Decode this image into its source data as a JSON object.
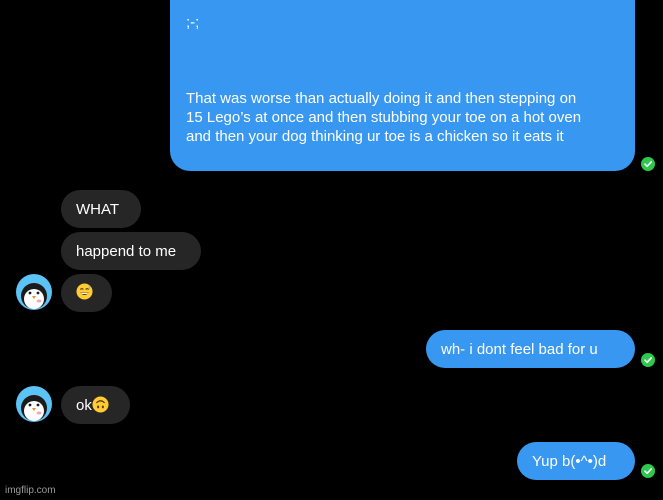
{
  "colors": {
    "background": "#000000",
    "outgoing_bubble": "#3897f0",
    "incoming_bubble": "#262626",
    "read_check": "#2dc84d"
  },
  "messages": [
    {
      "direction": "outgoing",
      "lines": [
        ";-;",
        "",
        "",
        "",
        "That was worse than actually doing it and then stepping on",
        "15 Lego’s at once and then stubbing your toe on a hot oven",
        "and then your dog thinking ur toe is a chicken so it eats it"
      ],
      "status_icon": "check-circle-icon"
    },
    {
      "direction": "incoming",
      "text": "WHAT"
    },
    {
      "direction": "incoming",
      "text": "happend to me"
    },
    {
      "direction": "incoming",
      "emoji": "grinning-sweat-emoji",
      "avatar": "penguin-avatar"
    },
    {
      "direction": "outgoing",
      "text": "wh- i dont feel bad for u",
      "status_icon": "check-circle-icon"
    },
    {
      "direction": "incoming",
      "text": "ok",
      "emoji": "upside-down-face-emoji",
      "avatar": "penguin-avatar"
    },
    {
      "direction": "outgoing",
      "text": "Yup b(•^•)d",
      "status_icon": "check-circle-icon"
    }
  ],
  "watermark": "imgflip.com"
}
